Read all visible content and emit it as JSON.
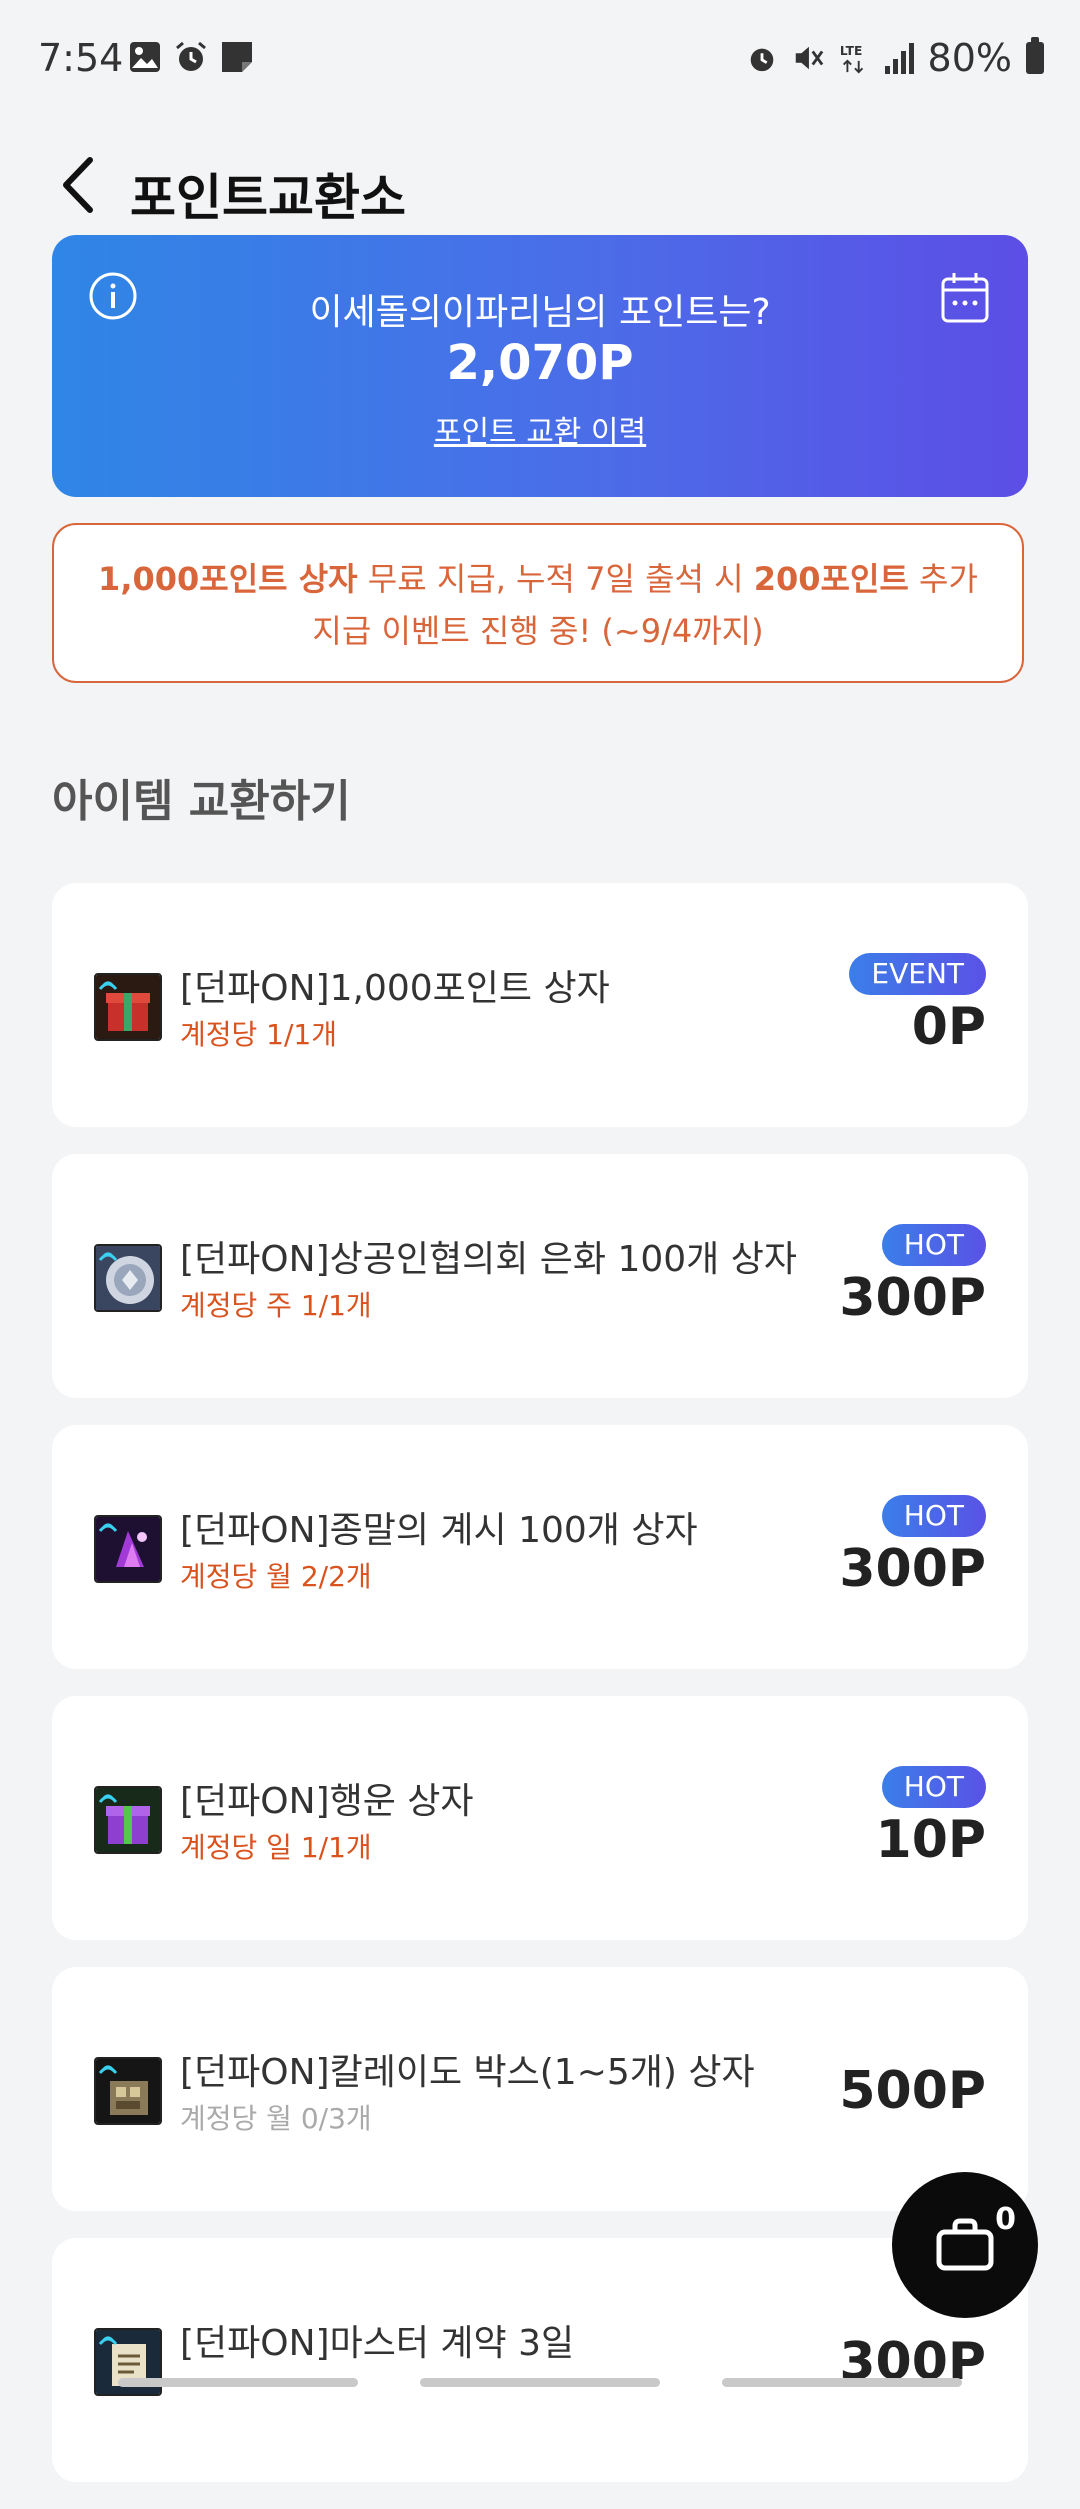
{
  "status_bar": {
    "time": "7:54",
    "battery": "80%"
  },
  "header": {
    "title": "포인트교환소"
  },
  "points_card": {
    "question": "이세돌의이파리님의 포인트는?",
    "points": "2,070P",
    "history_link": "포인트 교환 이력"
  },
  "event_banner": {
    "part1": "1,000포인트 상자",
    "part2": " 무료 지급, 누적 7일 출석 시 ",
    "part3": "200포인트",
    "part4": " 추가",
    "line2": "지급 이벤트 진행 중! (~9/4까지)"
  },
  "section": {
    "title": "아이템 교환하기"
  },
  "items": [
    {
      "name": "[던파ON]1,000포인트 상자",
      "limit": "계정당 1/1개",
      "badge": "EVENT",
      "price": "0P"
    },
    {
      "name": "[던파ON]상공인협의회 은화 100개 상자",
      "limit": "계정당 주 1/1개",
      "badge": "HOT",
      "price": "300P"
    },
    {
      "name": "[던파ON]종말의 계시 100개 상자",
      "limit": "계정당 월 2/2개",
      "badge": "HOT",
      "price": "300P"
    },
    {
      "name": "[던파ON]행운 상자",
      "limit": "계정당 일 1/1개",
      "badge": "HOT",
      "price": "10P"
    },
    {
      "name": "[던파ON]칼레이도 박스(1~5개) 상자",
      "limit": "계정당 월 0/3개",
      "badge": "",
      "price": "500P"
    },
    {
      "name": "[던파ON]마스터 계약 3일",
      "limit": "",
      "badge": "",
      "price": "300P"
    }
  ],
  "cart": {
    "count": "0"
  },
  "colors": {
    "accent_orange": "#d9663b",
    "badge_gradient_start": "#3b7ee9",
    "badge_gradient_end": "#5a52e6"
  }
}
